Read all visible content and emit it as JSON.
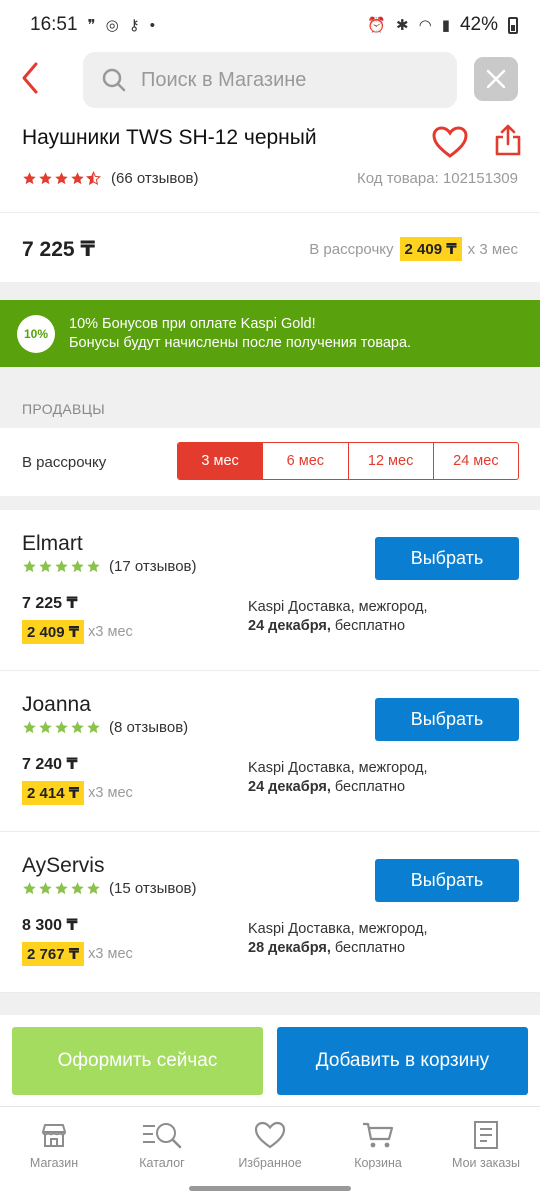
{
  "status_bar": {
    "time": "16:51",
    "battery": "42%"
  },
  "search": {
    "placeholder": "Поиск в Магазине"
  },
  "product": {
    "title": "Наушники TWS SH-12 черный",
    "rating": 4.5,
    "reviews": "(66 отзывов)",
    "code": "Код товара: 102151309",
    "price": "7 225 ₸",
    "installment_prefix": "В рассрочку",
    "installment_amount": "2 409 ₸",
    "installment_suffix": "x 3 мес"
  },
  "bonus": {
    "badge": "10%",
    "line1": "10% Бонусов при оплате Kaspi Gold!",
    "line2": "Бонусы будут начислены после получения товара."
  },
  "sellers_heading": "ПРОДАВЦЫ",
  "terms": {
    "label": "В рассрочку",
    "options": [
      "3 мес",
      "6 мес",
      "12 мес",
      "24 мес"
    ],
    "selected": "3 мес"
  },
  "sellers": [
    {
      "name": "Elmart",
      "reviews": "(17 отзывов)",
      "price": "7 225 ₸",
      "monthly": "2 409 ₸",
      "term": "x3 мес",
      "button": "Выбрать",
      "delivery_line1": "Kaspi Доставка, межгород,",
      "delivery_date": "24 декабря,",
      "delivery_cost": "бесплатно"
    },
    {
      "name": "Joanna",
      "reviews": "(8 отзывов)",
      "price": "7 240 ₸",
      "monthly": "2 414 ₸",
      "term": "x3 мес",
      "button": "Выбрать",
      "delivery_line1": "Kaspi Доставка, межгород,",
      "delivery_date": "24 декабря,",
      "delivery_cost": "бесплатно"
    },
    {
      "name": "AyServis",
      "reviews": "(15 отзывов)",
      "price": "8 300 ₸",
      "monthly": "2 767 ₸",
      "term": "x3 мес",
      "button": "Выбрать",
      "delivery_line1": "Kaspi Доставка, межгород,",
      "delivery_date": "28 декабря,",
      "delivery_cost": "бесплатно"
    }
  ],
  "actions": {
    "buy_now": "Оформить сейчас",
    "add_to_cart": "Добавить в корзину"
  },
  "nav": [
    {
      "label": "Магазин",
      "icon": "store-icon"
    },
    {
      "label": "Каталог",
      "icon": "catalog-icon"
    },
    {
      "label": "Избранное",
      "icon": "heart-icon"
    },
    {
      "label": "Корзина",
      "icon": "cart-icon"
    },
    {
      "label": "Мои заказы",
      "icon": "orders-icon"
    }
  ],
  "colors": {
    "accent_red": "#e33b2e",
    "blue": "#0a7fd1",
    "green": "#5aa10e",
    "light_green": "#a3dc5f",
    "yellow": "#ffd21f",
    "star_red": "#e33b2e",
    "star_green": "#8bc34a"
  }
}
